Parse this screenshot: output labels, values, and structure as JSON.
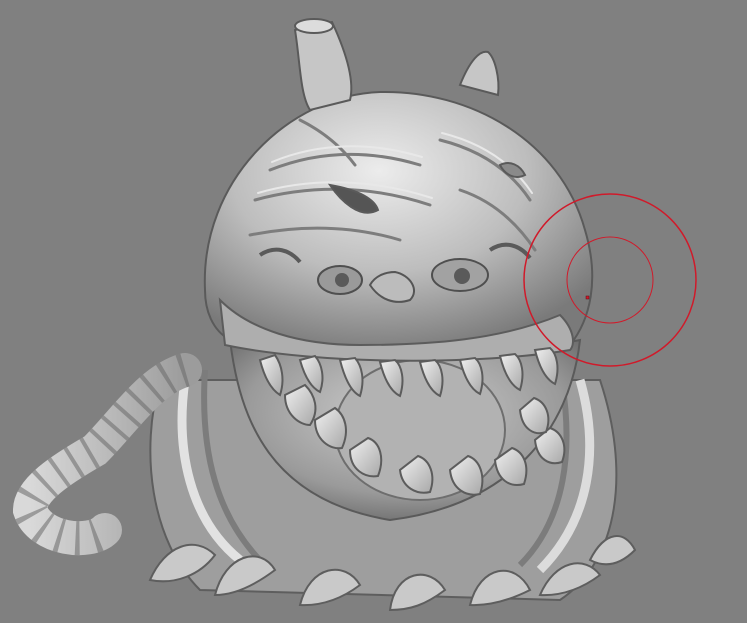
{
  "viewport": {
    "background": "#808080",
    "mesh_color": "#bdbdbd",
    "mesh_shadow": "#5a5a5a",
    "mesh_highlight": "#ececec"
  },
  "brush": {
    "color": "#d01a2a",
    "icon": "brush-cursor-icon"
  },
  "model": {
    "icon": "sculpted-monster-mesh"
  }
}
